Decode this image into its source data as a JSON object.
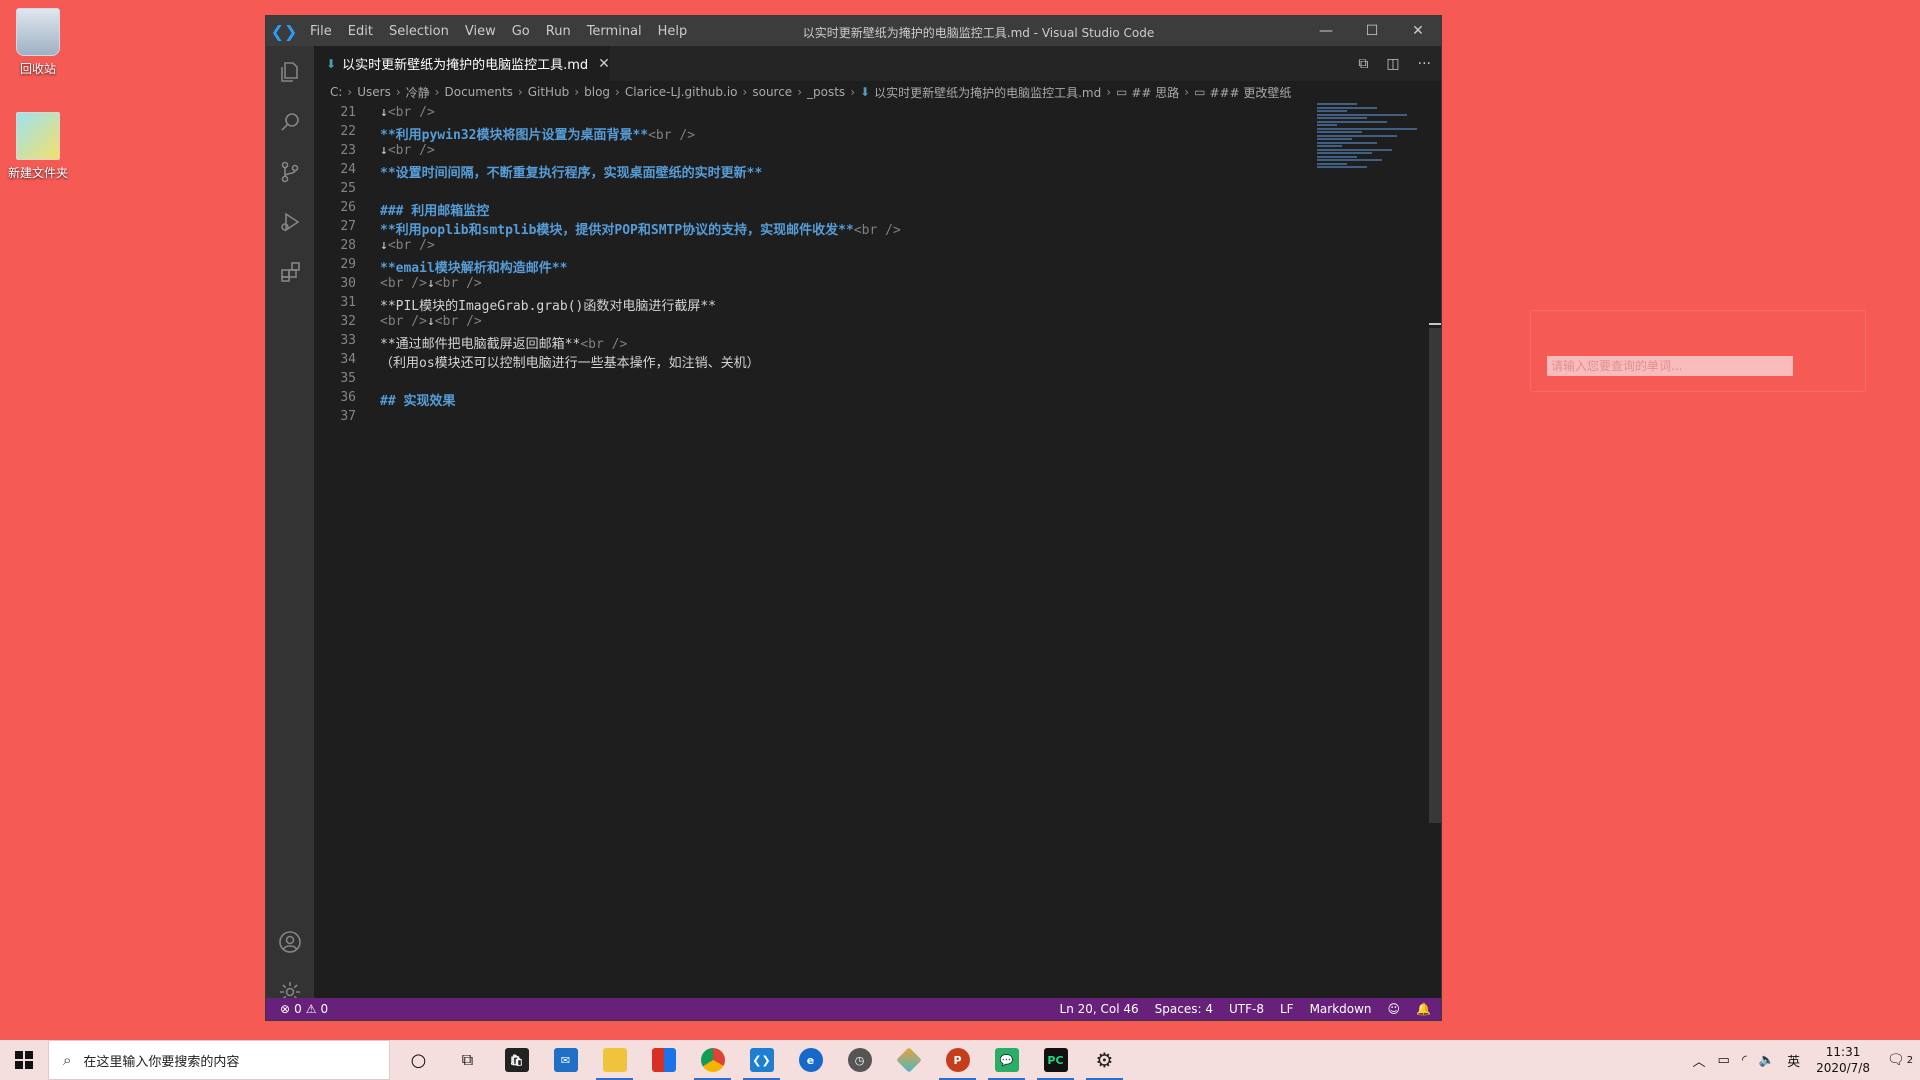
{
  "desktop": {
    "icons": [
      {
        "label": "回收站"
      },
      {
        "label": "新建文件夹"
      }
    ],
    "dict_placeholder": "请输入您要查询的单词..."
  },
  "window": {
    "title": "以实时更新壁纸为掩护的电脑监控工具.md - Visual Studio Code",
    "menu": [
      "File",
      "Edit",
      "Selection",
      "View",
      "Go",
      "Run",
      "Terminal",
      "Help"
    ]
  },
  "tab": {
    "label": "以实时更新壁纸为掩护的电脑监控工具.md"
  },
  "breadcrumb": [
    "C:",
    "Users",
    "冷静",
    "Documents",
    "GitHub",
    "blog",
    "Clarice-LJ.github.io",
    "source",
    "_posts",
    "以实时更新壁纸为掩护的电脑监控工具.md",
    "## 思路",
    "### 更改壁纸"
  ],
  "editor": {
    "lines": [
      {
        "n": "21",
        "parts": [
          [
            "plain",
            "↓"
          ],
          [
            "tag",
            "<br />"
          ]
        ]
      },
      {
        "n": "22",
        "parts": [
          [
            "bold",
            "**利用pywin32模块将图片设置为桌面背景**"
          ],
          [
            "tag",
            "<br />"
          ]
        ]
      },
      {
        "n": "23",
        "parts": [
          [
            "plain",
            "↓"
          ],
          [
            "tag",
            "<br />"
          ]
        ]
      },
      {
        "n": "24",
        "parts": [
          [
            "bold",
            "**设置时间间隔，不断重复执行程序，实现桌面壁纸的实时更新**"
          ]
        ]
      },
      {
        "n": "25",
        "parts": []
      },
      {
        "n": "26",
        "parts": [
          [
            "head",
            "### 利用邮箱监控"
          ]
        ]
      },
      {
        "n": "27",
        "parts": [
          [
            "bold",
            "**利用poplib和smtplib模块，提供对POP和SMTP协议的支持，实现邮件收发**"
          ],
          [
            "tag",
            "<br />"
          ]
        ]
      },
      {
        "n": "28",
        "parts": [
          [
            "plain",
            "↓"
          ],
          [
            "tag",
            "<br />"
          ]
        ]
      },
      {
        "n": "29",
        "parts": [
          [
            "bold",
            "**email模块解析和构造邮件**"
          ]
        ]
      },
      {
        "n": "30",
        "parts": [
          [
            "tag",
            "<br />"
          ],
          [
            "plain",
            "↓"
          ],
          [
            "tag",
            "<br />"
          ]
        ]
      },
      {
        "n": "31",
        "parts": [
          [
            "plain",
            "**PIL模块的ImageGrab.grab()函数对电脑进行截屏**"
          ]
        ]
      },
      {
        "n": "32",
        "parts": [
          [
            "tag",
            "<br />"
          ],
          [
            "plain",
            "↓"
          ],
          [
            "tag",
            "<br />"
          ]
        ]
      },
      {
        "n": "33",
        "parts": [
          [
            "plain",
            "**通过邮件把电脑截屏返回邮箱**"
          ],
          [
            "tag",
            "<br />"
          ]
        ]
      },
      {
        "n": "34",
        "parts": [
          [
            "plain",
            "（利用os模块还可以控制电脑进行一些基本操作，如注销、关机）"
          ]
        ]
      },
      {
        "n": "35",
        "parts": []
      },
      {
        "n": "36",
        "parts": [
          [
            "head",
            "## 实现效果"
          ]
        ]
      },
      {
        "n": "37",
        "parts": []
      }
    ]
  },
  "statusbar": {
    "errors": "0",
    "warnings": "0",
    "position": "Ln 20, Col 46",
    "spaces": "Spaces: 4",
    "encoding": "UTF-8",
    "eol": "LF",
    "language": "Markdown"
  },
  "taskbar": {
    "search_placeholder": "在这里输入你要搜索的内容",
    "ime": "英",
    "time": "11:31",
    "date": "2020/7/8",
    "notifications": "2"
  },
  "colors": {
    "desktop": "#f55a55",
    "statusbar": "#68217a",
    "editor_bg": "#1e1e1e"
  }
}
